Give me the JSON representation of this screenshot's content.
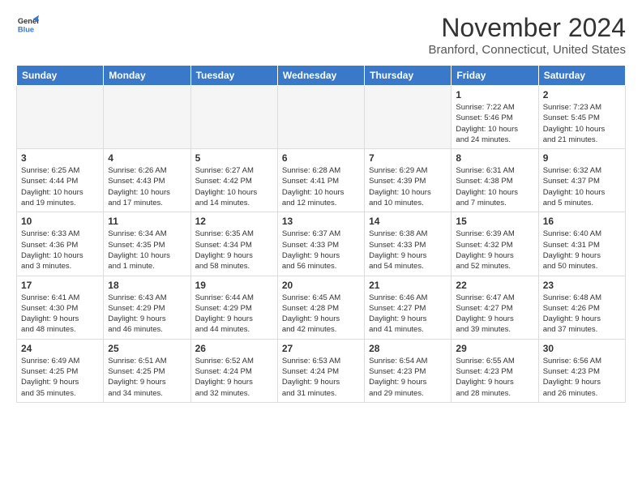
{
  "header": {
    "logo_line1": "General",
    "logo_line2": "Blue",
    "month": "November 2024",
    "location": "Branford, Connecticut, United States"
  },
  "weekdays": [
    "Sunday",
    "Monday",
    "Tuesday",
    "Wednesday",
    "Thursday",
    "Friday",
    "Saturday"
  ],
  "weeks": [
    [
      {
        "day": "",
        "info": ""
      },
      {
        "day": "",
        "info": ""
      },
      {
        "day": "",
        "info": ""
      },
      {
        "day": "",
        "info": ""
      },
      {
        "day": "",
        "info": ""
      },
      {
        "day": "1",
        "info": "Sunrise: 7:22 AM\nSunset: 5:46 PM\nDaylight: 10 hours\nand 24 minutes."
      },
      {
        "day": "2",
        "info": "Sunrise: 7:23 AM\nSunset: 5:45 PM\nDaylight: 10 hours\nand 21 minutes."
      }
    ],
    [
      {
        "day": "3",
        "info": "Sunrise: 6:25 AM\nSunset: 4:44 PM\nDaylight: 10 hours\nand 19 minutes."
      },
      {
        "day": "4",
        "info": "Sunrise: 6:26 AM\nSunset: 4:43 PM\nDaylight: 10 hours\nand 17 minutes."
      },
      {
        "day": "5",
        "info": "Sunrise: 6:27 AM\nSunset: 4:42 PM\nDaylight: 10 hours\nand 14 minutes."
      },
      {
        "day": "6",
        "info": "Sunrise: 6:28 AM\nSunset: 4:41 PM\nDaylight: 10 hours\nand 12 minutes."
      },
      {
        "day": "7",
        "info": "Sunrise: 6:29 AM\nSunset: 4:39 PM\nDaylight: 10 hours\nand 10 minutes."
      },
      {
        "day": "8",
        "info": "Sunrise: 6:31 AM\nSunset: 4:38 PM\nDaylight: 10 hours\nand 7 minutes."
      },
      {
        "day": "9",
        "info": "Sunrise: 6:32 AM\nSunset: 4:37 PM\nDaylight: 10 hours\nand 5 minutes."
      }
    ],
    [
      {
        "day": "10",
        "info": "Sunrise: 6:33 AM\nSunset: 4:36 PM\nDaylight: 10 hours\nand 3 minutes."
      },
      {
        "day": "11",
        "info": "Sunrise: 6:34 AM\nSunset: 4:35 PM\nDaylight: 10 hours\nand 1 minute."
      },
      {
        "day": "12",
        "info": "Sunrise: 6:35 AM\nSunset: 4:34 PM\nDaylight: 9 hours\nand 58 minutes."
      },
      {
        "day": "13",
        "info": "Sunrise: 6:37 AM\nSunset: 4:33 PM\nDaylight: 9 hours\nand 56 minutes."
      },
      {
        "day": "14",
        "info": "Sunrise: 6:38 AM\nSunset: 4:33 PM\nDaylight: 9 hours\nand 54 minutes."
      },
      {
        "day": "15",
        "info": "Sunrise: 6:39 AM\nSunset: 4:32 PM\nDaylight: 9 hours\nand 52 minutes."
      },
      {
        "day": "16",
        "info": "Sunrise: 6:40 AM\nSunset: 4:31 PM\nDaylight: 9 hours\nand 50 minutes."
      }
    ],
    [
      {
        "day": "17",
        "info": "Sunrise: 6:41 AM\nSunset: 4:30 PM\nDaylight: 9 hours\nand 48 minutes."
      },
      {
        "day": "18",
        "info": "Sunrise: 6:43 AM\nSunset: 4:29 PM\nDaylight: 9 hours\nand 46 minutes."
      },
      {
        "day": "19",
        "info": "Sunrise: 6:44 AM\nSunset: 4:29 PM\nDaylight: 9 hours\nand 44 minutes."
      },
      {
        "day": "20",
        "info": "Sunrise: 6:45 AM\nSunset: 4:28 PM\nDaylight: 9 hours\nand 42 minutes."
      },
      {
        "day": "21",
        "info": "Sunrise: 6:46 AM\nSunset: 4:27 PM\nDaylight: 9 hours\nand 41 minutes."
      },
      {
        "day": "22",
        "info": "Sunrise: 6:47 AM\nSunset: 4:27 PM\nDaylight: 9 hours\nand 39 minutes."
      },
      {
        "day": "23",
        "info": "Sunrise: 6:48 AM\nSunset: 4:26 PM\nDaylight: 9 hours\nand 37 minutes."
      }
    ],
    [
      {
        "day": "24",
        "info": "Sunrise: 6:49 AM\nSunset: 4:25 PM\nDaylight: 9 hours\nand 35 minutes."
      },
      {
        "day": "25",
        "info": "Sunrise: 6:51 AM\nSunset: 4:25 PM\nDaylight: 9 hours\nand 34 minutes."
      },
      {
        "day": "26",
        "info": "Sunrise: 6:52 AM\nSunset: 4:24 PM\nDaylight: 9 hours\nand 32 minutes."
      },
      {
        "day": "27",
        "info": "Sunrise: 6:53 AM\nSunset: 4:24 PM\nDaylight: 9 hours\nand 31 minutes."
      },
      {
        "day": "28",
        "info": "Sunrise: 6:54 AM\nSunset: 4:23 PM\nDaylight: 9 hours\nand 29 minutes."
      },
      {
        "day": "29",
        "info": "Sunrise: 6:55 AM\nSunset: 4:23 PM\nDaylight: 9 hours\nand 28 minutes."
      },
      {
        "day": "30",
        "info": "Sunrise: 6:56 AM\nSunset: 4:23 PM\nDaylight: 9 hours\nand 26 minutes."
      }
    ]
  ]
}
